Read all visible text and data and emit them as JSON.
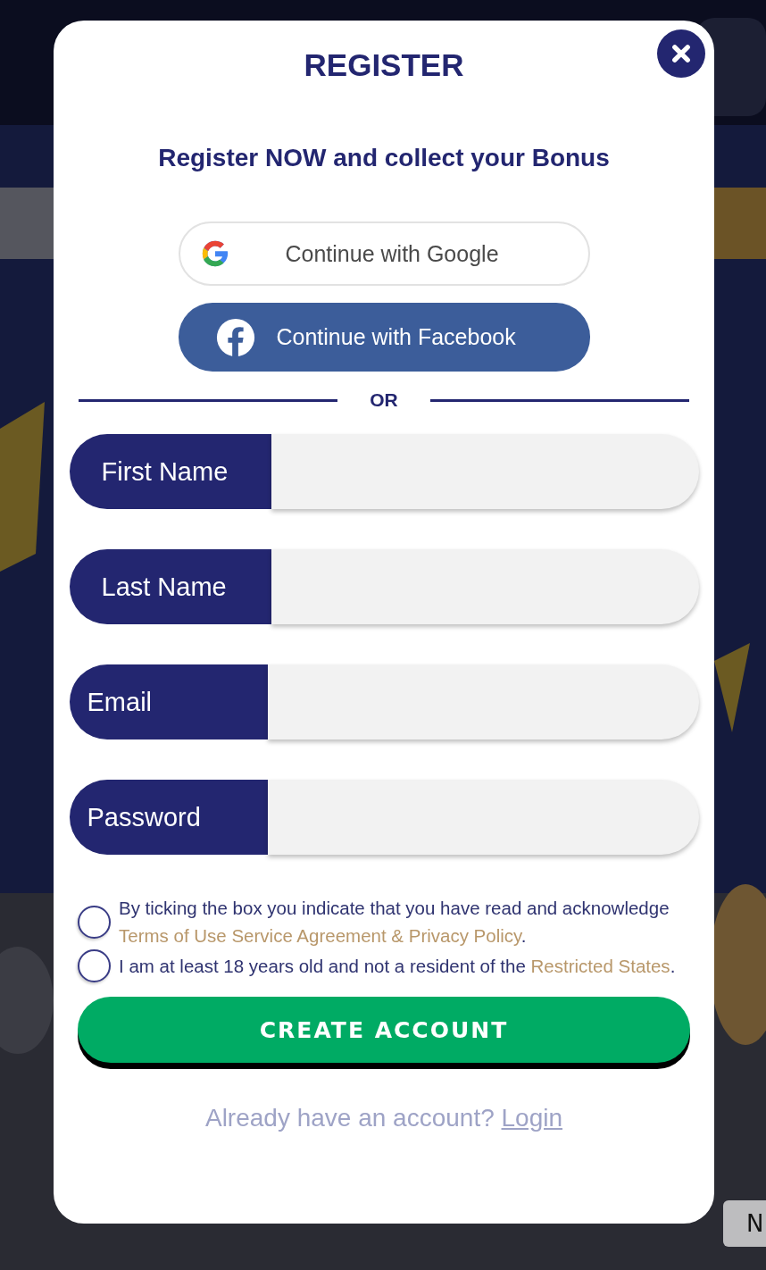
{
  "corner_button": {
    "label": "N"
  },
  "dialog": {
    "title": "REGISTER",
    "subtitle": "Register NOW and collect your Bonus",
    "social_buttons": [
      {
        "kind": "google",
        "label": "Continue with Google"
      },
      {
        "kind": "facebook",
        "label": "Continue with Facebook"
      }
    ],
    "divider": "OR",
    "fields": [
      {
        "label": "First Name"
      },
      {
        "label": "Last Name"
      },
      {
        "label": "Email"
      },
      {
        "label": "Password"
      }
    ],
    "consents": [
      {
        "checked": false,
        "text": "By ticking the box you indicate that you have read and acknowledge ",
        "link": "Terms of Use Service Agreement & Privacy Policy",
        "after": "."
      },
      {
        "checked": false,
        "text": "I am at least 18 years old and not a resident of the ",
        "link": "Restricted States",
        "after": "."
      }
    ],
    "submit": "CREATE ACCOUNT",
    "footer": {
      "text": "Already have an account?",
      "link": "Login"
    }
  }
}
